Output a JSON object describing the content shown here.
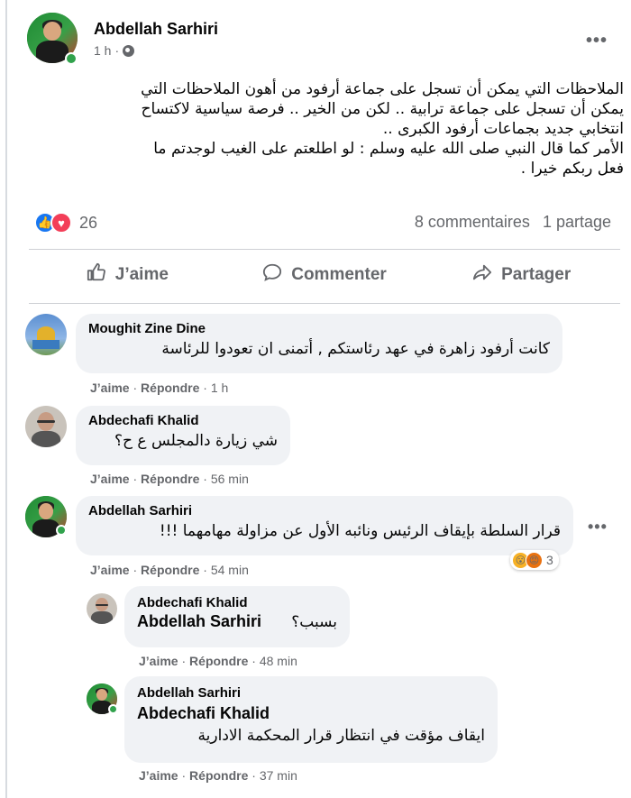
{
  "post": {
    "author": "Abdellah Sarhiri",
    "time": "1 h",
    "visibility_icon": "globe-icon",
    "text": "الملاحظات التي يمكن أن تسجل على جماعة أرفود من أهون الملاحظات التي\nيمكن أن تسجل على جماعة ترابية .. لكن من الخير  .. فرصة  سياسية لاكتساح\nانتخابي جديد بجماعات أرفود الكبرى ..\nالأمر كما قال النبي صلى الله عليه وسلم : لو اطلعتم على الغيب لوجدتم ما\nفعل ربكم خيرا .",
    "reaction_count": "26",
    "comments_count": "8 commentaires",
    "shares_count": "1 partage",
    "reaction_icons": [
      "like-icon",
      "love-icon"
    ]
  },
  "actions": {
    "like": "J’aime",
    "comment": "Commenter",
    "share": "Partager"
  },
  "comments": [
    {
      "author": "Moughit Zine Dine",
      "text": "كانت أرفود زاهرة في عهد رئاستكم , أتمنى ان تعودوا للرئاسة",
      "like": "J’aime",
      "reply": "Répondre",
      "time": "1 h"
    },
    {
      "author": "Abdechafi Khalid",
      "text": "شي زيارة دالمجلس ع ح؟",
      "like": "J’aime",
      "reply": "Répondre",
      "time": "56 min"
    },
    {
      "author": "Abdellah Sarhiri",
      "text": "قرار السلطة بإيقاف الرئيس ونائبه الأول عن مزاولة مهامهما !!!",
      "like": "J’aime",
      "reply": "Répondre",
      "time": "54 min",
      "reaction_count": "3"
    }
  ],
  "replies": [
    {
      "author": "Abdechafi Khalid",
      "tag": "Abdellah Sarhiri",
      "text": "بسبب؟",
      "like": "J’aime",
      "reply": "Répondre",
      "time": "48 min"
    },
    {
      "author": "Abdellah Sarhiri",
      "tag": "Abdechafi Khalid",
      "text": "ايقاف مؤقت في انتظار قرار المحكمة الادارية",
      "like": "J’aime",
      "reply": "Répondre",
      "time": "37 min"
    }
  ],
  "colors": {
    "accent": "#1877f2",
    "bubble": "#f0f2f5",
    "muted": "#65676b",
    "online": "#31a24c"
  }
}
